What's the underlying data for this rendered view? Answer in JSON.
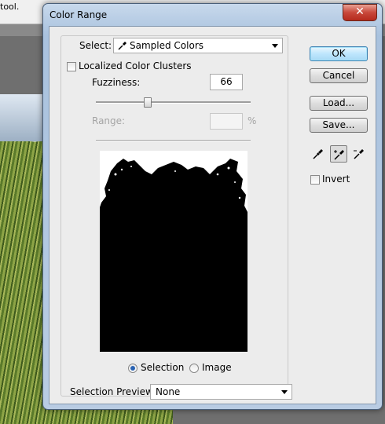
{
  "background_app": {
    "top_text": "tool."
  },
  "dialog": {
    "title": "Color Range",
    "close_glyph": "✕",
    "select_label": "Select:",
    "select_value": "Sampled Colors",
    "localized_label": "Localized Color Clusters",
    "fuzziness_label": "Fuzziness:",
    "fuzziness_value": "66",
    "fuzziness_slider_level": 0.33,
    "range_label": "Range:",
    "range_value": "",
    "range_unit": "%",
    "view_selection_label": "Selection",
    "view_image_label": "Image",
    "view_selected": "Selection",
    "preview_mode_label": "Selection Preview:",
    "preview_mode_value": "None",
    "localized_checked": false,
    "invert_checked": false
  },
  "buttons": {
    "ok": "OK",
    "cancel": "Cancel",
    "load": "Load...",
    "save": "Save...",
    "invert": "Invert"
  },
  "tools": [
    {
      "icon": "eyedropper-icon"
    },
    {
      "icon": "eyedropper-plus-icon",
      "active": true
    },
    {
      "icon": "eyedropper-minus-icon"
    }
  ],
  "colors": {
    "title_bar": "#b9cce3",
    "close_button": "#c8473a",
    "default_button": "#bee6fd",
    "selection_mask": "#000000"
  }
}
